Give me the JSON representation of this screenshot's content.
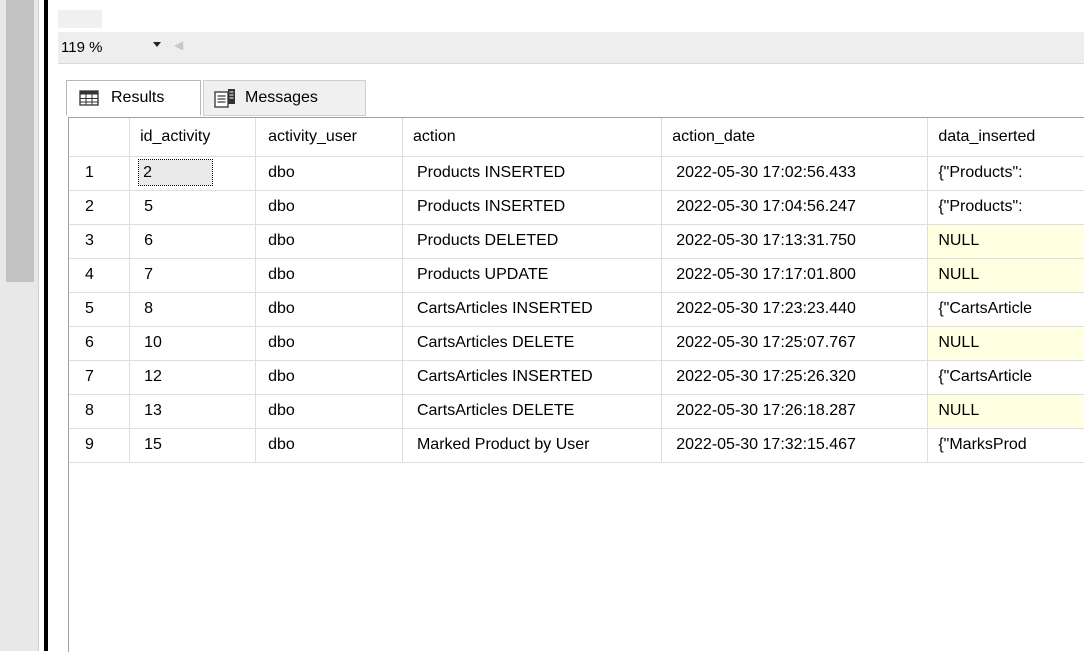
{
  "zoom": {
    "value": "119 %"
  },
  "tabs": [
    {
      "label": "Results"
    },
    {
      "label": "Messages"
    }
  ],
  "grid": {
    "columns": [
      "",
      "id_activity",
      "activity_user",
      "action",
      "action_date",
      "data_inserted"
    ],
    "rows": [
      [
        "1",
        "2",
        "dbo",
        "Products INSERTED",
        "2022-05-30 17:02:56.433",
        "{\"Products\":"
      ],
      [
        "2",
        "5",
        "dbo",
        "Products INSERTED",
        "2022-05-30 17:04:56.247",
        "{\"Products\":"
      ],
      [
        "3",
        "6",
        "dbo",
        "Products DELETED",
        "2022-05-30 17:13:31.750",
        "NULL"
      ],
      [
        "4",
        "7",
        "dbo",
        "Products UPDATE",
        "2022-05-30 17:17:01.800",
        "NULL"
      ],
      [
        "5",
        "8",
        "dbo",
        "CartsArticles INSERTED",
        "2022-05-30 17:23:23.440",
        "{\"CartsArticle"
      ],
      [
        "6",
        "10",
        "dbo",
        "CartsArticles DELETE",
        "2022-05-30 17:25:07.767",
        "NULL"
      ],
      [
        "7",
        "12",
        "dbo",
        "CartsArticles INSERTED",
        "2022-05-30 17:25:26.320",
        "{\"CartsArticle"
      ],
      [
        "8",
        "13",
        "dbo",
        "CartsArticles DELETE",
        "2022-05-30 17:26:18.287",
        "NULL"
      ],
      [
        "9",
        "15",
        "dbo",
        "Marked Product by User",
        "2022-05-30 17:32:15.467",
        "{\"MarksProd"
      ]
    ]
  },
  "icons": {
    "results_tab": "grid-icon",
    "messages_tab": "messages-icon",
    "zoom_dropdown": "chevron-down-icon",
    "scroll_left": "scroll-left-arrow-icon"
  },
  "colors": {
    "null_cell": "#ffffe1",
    "selected_cell": "#eaeaea"
  }
}
